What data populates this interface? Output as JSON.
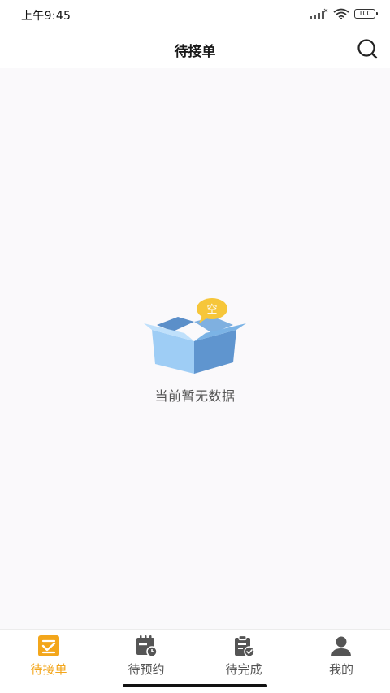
{
  "status_bar": {
    "time": "上午9:45",
    "battery": "100"
  },
  "header": {
    "title": "待接单",
    "search_icon": "search-icon"
  },
  "empty_state": {
    "badge_text": "空",
    "message": "当前暂无数据"
  },
  "tabbar": {
    "active_color": "#f3a61b",
    "inactive_color": "#555555",
    "items": [
      {
        "label": "待接单",
        "icon": "pending-orders-icon",
        "active": true
      },
      {
        "label": "待预约",
        "icon": "calendar-clock-icon",
        "active": false
      },
      {
        "label": "待完成",
        "icon": "clipboard-check-icon",
        "active": false
      },
      {
        "label": "我的",
        "icon": "user-icon",
        "active": false
      }
    ]
  }
}
